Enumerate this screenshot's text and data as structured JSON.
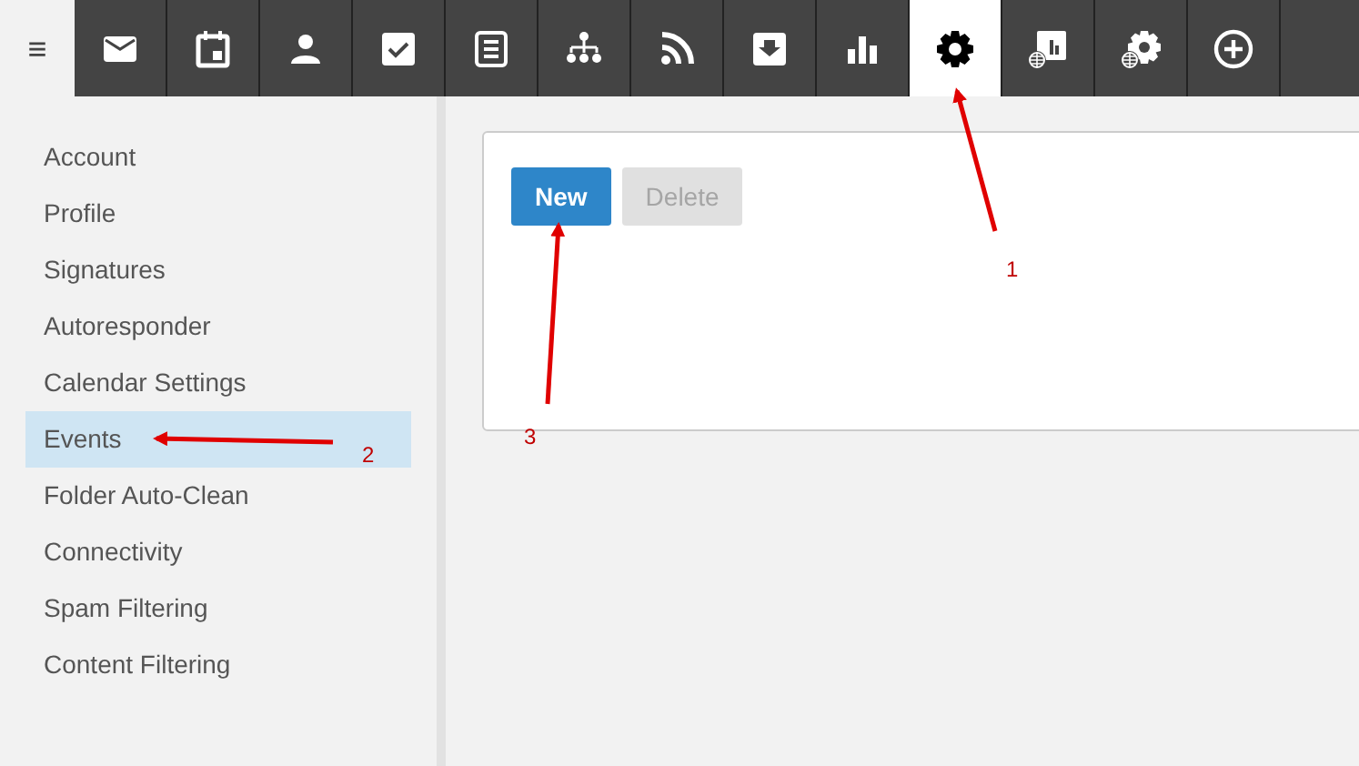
{
  "toolbar": {
    "menu_icon": "≡",
    "tabs": [
      {
        "kind": "mail",
        "selected": false
      },
      {
        "kind": "calendar",
        "selected": false
      },
      {
        "kind": "person",
        "selected": false
      },
      {
        "kind": "task",
        "selected": false
      },
      {
        "kind": "notes",
        "selected": false
      },
      {
        "kind": "tree",
        "selected": false
      },
      {
        "kind": "rss",
        "selected": false
      },
      {
        "kind": "inbox",
        "selected": false
      },
      {
        "kind": "chart",
        "selected": false
      },
      {
        "kind": "gear",
        "selected": true
      },
      {
        "kind": "chartglobe",
        "selected": false
      },
      {
        "kind": "gearglobe",
        "selected": false
      },
      {
        "kind": "plus",
        "selected": false
      }
    ]
  },
  "sidebar": {
    "items": [
      {
        "label": "Account",
        "selected": false
      },
      {
        "label": "Profile",
        "selected": false
      },
      {
        "label": "Signatures",
        "selected": false
      },
      {
        "label": "Autoresponder",
        "selected": false
      },
      {
        "label": "Calendar Settings",
        "selected": false
      },
      {
        "label": "Events",
        "selected": true
      },
      {
        "label": "Folder Auto-Clean",
        "selected": false
      },
      {
        "label": "Connectivity",
        "selected": false
      },
      {
        "label": "Spam Filtering",
        "selected": false
      },
      {
        "label": "Content Filtering",
        "selected": false
      }
    ]
  },
  "panel": {
    "buttons": [
      {
        "label": "New",
        "disabled": false
      },
      {
        "label": "Delete",
        "disabled": true
      }
    ]
  },
  "annotations": [
    {
      "label": "1"
    },
    {
      "label": "2"
    },
    {
      "label": "3"
    }
  ]
}
